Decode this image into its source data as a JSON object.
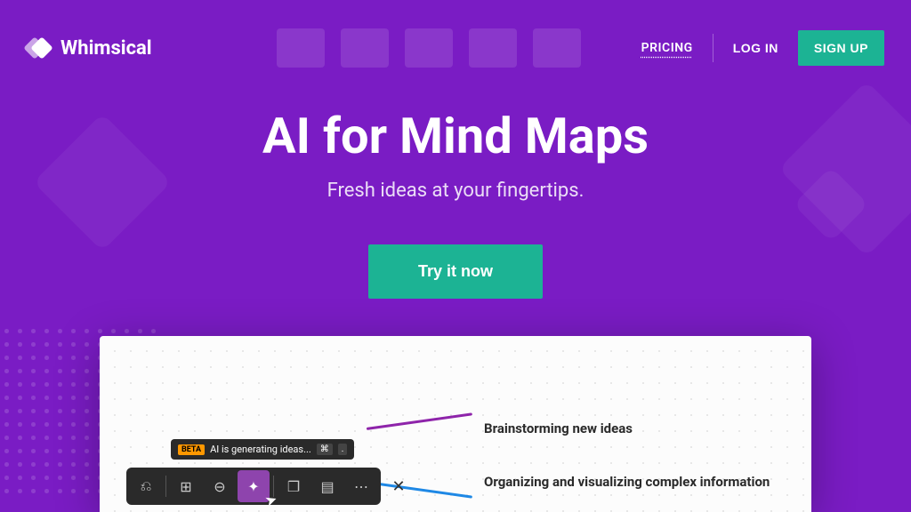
{
  "brand": "Whimsical",
  "nav": {
    "pricing": "PRICING",
    "login": "LOG IN",
    "signup": "SIGN UP"
  },
  "hero": {
    "title": "AI for Mind Maps",
    "subtitle": "Fresh ideas at your fingertips.",
    "cta": "Try it now"
  },
  "preview": {
    "branches": [
      "Brainstorming new ideas",
      "Organizing and visualizing complex information"
    ],
    "tooltip": {
      "badge": "BETA",
      "text": "AI is generating ideas...",
      "shortcut1": "⌘",
      "shortcut2": "."
    }
  }
}
